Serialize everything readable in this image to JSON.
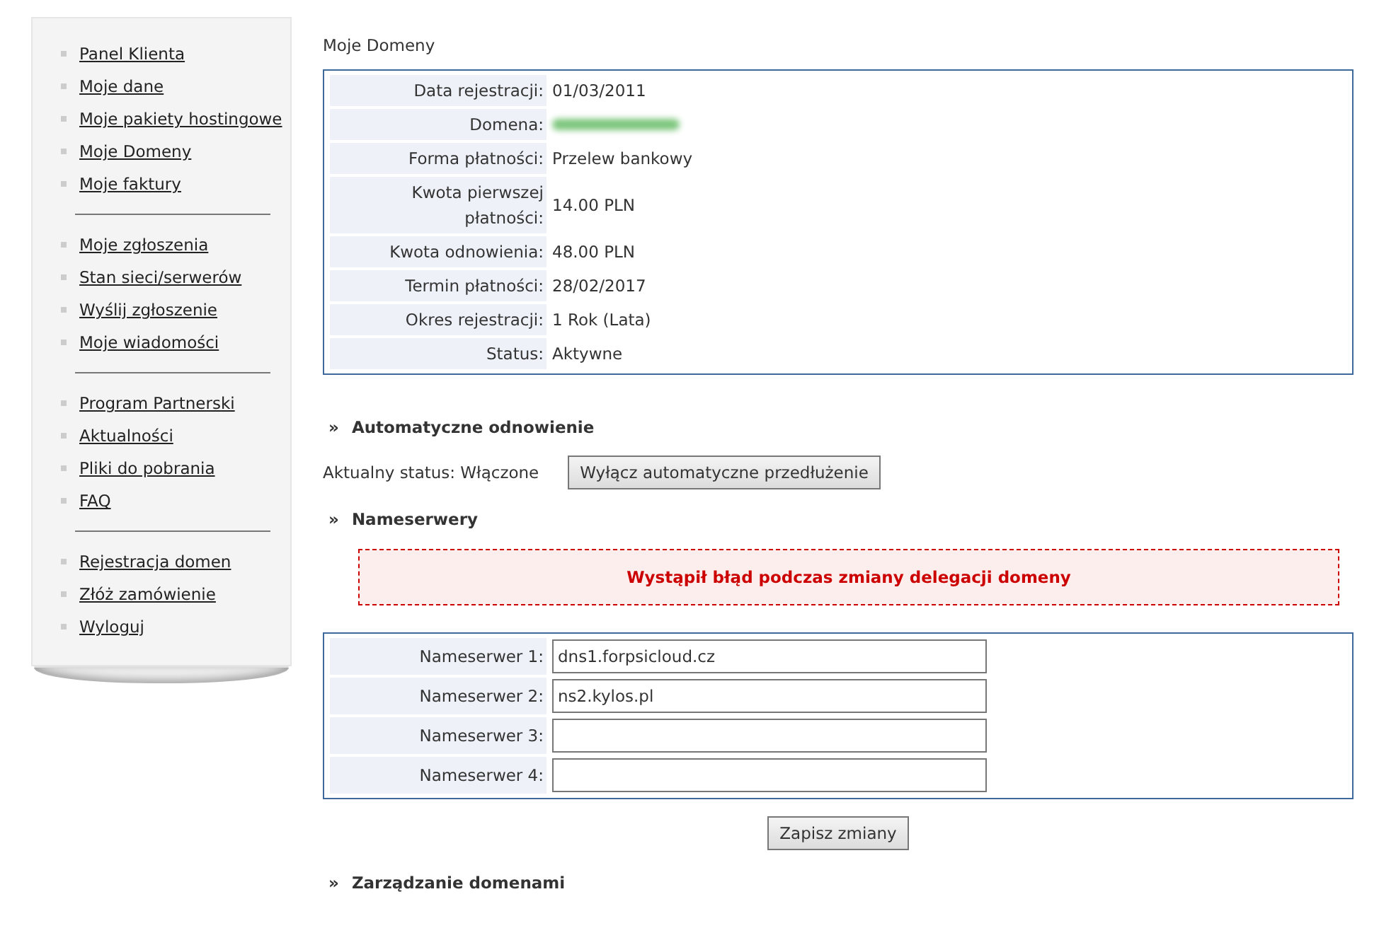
{
  "sidebar": {
    "groups": [
      {
        "items": [
          "Panel Klienta",
          "Moje dane",
          "Moje pakiety hostingowe",
          "Moje Domeny",
          "Moje faktury"
        ]
      },
      {
        "items": [
          "Moje zgłoszenia",
          "Stan sieci/serwerów",
          "Wyślij zgłoszenie",
          "Moje wiadomości"
        ]
      },
      {
        "items": [
          "Program Partnerski",
          "Aktualności",
          "Pliki do pobrania",
          "FAQ"
        ]
      },
      {
        "items": [
          "Rejestracja domen",
          "Złóż zamówienie",
          "Wyloguj"
        ]
      }
    ]
  },
  "page_title": "Moje Domeny",
  "details": [
    {
      "label": "Data rejestracji:",
      "kind": "text",
      "value": "01/03/2011"
    },
    {
      "label": "Domena:",
      "kind": "redacted"
    },
    {
      "label": "Forma płatności:",
      "kind": "text",
      "value": "Przelew bankowy"
    },
    {
      "label": "Kwota pierwszej płatności:",
      "kind": "text",
      "value": "14.00 PLN"
    },
    {
      "label": "Kwota odnowienia:",
      "kind": "text",
      "value": "48.00 PLN"
    },
    {
      "label": "Termin płatności:",
      "kind": "text",
      "value": "28/02/2017"
    },
    {
      "label": "Okres rejestracji:",
      "kind": "text",
      "value": "1 Rok (Lata)"
    },
    {
      "label": "Status:",
      "kind": "text",
      "value": "Aktywne"
    }
  ],
  "auto_renewal": {
    "marker": "»",
    "heading": "Automatyczne odnowienie",
    "status": "Aktualny status: Włączone",
    "button": "Wyłącz automatyczne przedłużenie"
  },
  "nameservers": {
    "marker": "»",
    "heading": "Nameserwery",
    "error": "Wystąpił błąd podczas zmiany delegacji domeny",
    "fields": [
      {
        "label": "Nameserwer 1:",
        "value": "dns1.forpsicloud.cz"
      },
      {
        "label": "Nameserwer 2:",
        "value": "ns2.kylos.pl"
      },
      {
        "label": "Nameserwer 3:"
      },
      {
        "label": "Nameserwer 4:"
      }
    ],
    "save_button": "Zapisz zmiany"
  },
  "domain_management": {
    "marker": "»",
    "heading": "Zarządzanie domenami"
  }
}
